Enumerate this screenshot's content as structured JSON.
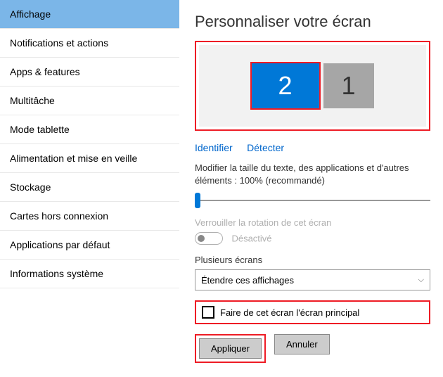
{
  "sidebar": {
    "items": [
      {
        "label": "Affichage"
      },
      {
        "label": "Notifications et actions"
      },
      {
        "label": "Apps & features"
      },
      {
        "label": "Multitâche"
      },
      {
        "label": "Mode tablette"
      },
      {
        "label": "Alimentation et mise en veille"
      },
      {
        "label": "Stockage"
      },
      {
        "label": "Cartes hors connexion"
      },
      {
        "label": "Applications par défaut"
      },
      {
        "label": "Informations système"
      }
    ]
  },
  "main": {
    "title": "Personnaliser votre écran",
    "monitors": {
      "m2": "2",
      "m1": "1"
    },
    "links": {
      "identify": "Identifier",
      "detect": "Détecter"
    },
    "scale_label": "Modifier la taille du texte, des applications et d'autres éléments : 100% (recommandé)",
    "lock_label": "Verrouiller la rotation de cet écran",
    "toggle_state": "Désactivé",
    "multi_label": "Plusieurs écrans",
    "multi_select": "Étendre ces affichages",
    "checkbox_label": "Faire de cet écran l'écran principal",
    "apply": "Appliquer",
    "cancel": "Annuler"
  }
}
